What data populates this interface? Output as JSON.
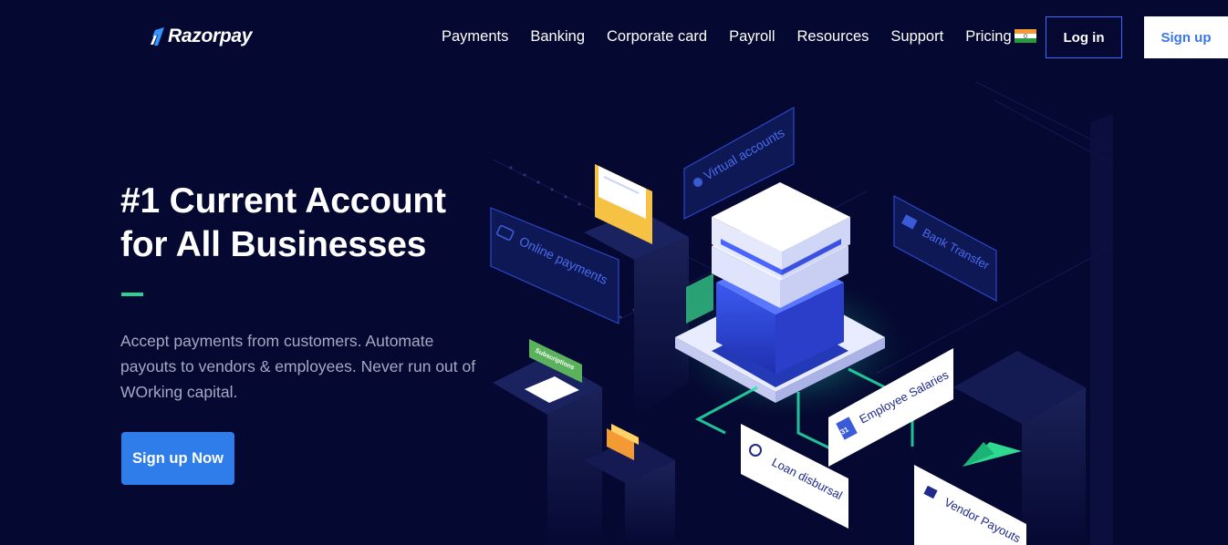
{
  "header": {
    "brand": "Razorpay",
    "nav": [
      {
        "label": "Payments"
      },
      {
        "label": "Banking"
      },
      {
        "label": "Corporate card"
      },
      {
        "label": "Payroll"
      },
      {
        "label": "Resources"
      },
      {
        "label": "Support"
      },
      {
        "label": "Pricing"
      }
    ],
    "pricing_flag_icon": "india-flag-icon",
    "login_label": "Log in",
    "signup_label": "Sign up"
  },
  "hero": {
    "title_line1": "#1 Current Account",
    "title_line2": "for All Businesses",
    "description": "Accept payments from customers. Automate payouts to vendors & employees. Never run out of WOrking capital.",
    "cta_label": "Sign up Now"
  },
  "illustration": {
    "labels": {
      "virtual_accounts": "Virtual accounts",
      "online_payments": "Online payments",
      "bank_transfer": "Bank Transfer",
      "subscriptions": "Subscriptions",
      "employee_salaries": "Employee Salaries",
      "loan_disbursal": "Loan disbursal",
      "vendor_payouts": "Vendor Payouts",
      "calendar_day": "31"
    },
    "icons": [
      "user-icon",
      "card-icon",
      "bank-icon",
      "phone-icon",
      "calendar-icon",
      "hand-coin-icon",
      "chat-icon",
      "paper-plane-icon",
      "invoice-icon",
      "wallet-icon"
    ]
  },
  "colors": {
    "background": "#050831",
    "accent_blue": "#2f7deb",
    "accent_green": "#2fcf8f",
    "login_border": "#3f6bff",
    "muted_text": "#a5a9c3"
  }
}
